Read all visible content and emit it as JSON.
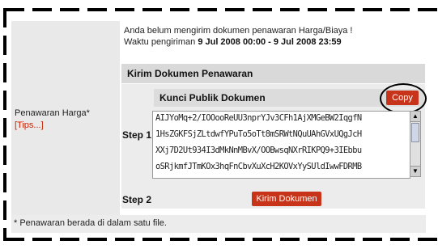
{
  "notice": {
    "line1": "Anda belum mengirim dokumen penawaran Harga/Biaya !",
    "line2_prefix": "Waktu pengiriman ",
    "line2_range": "9 Jul 2008 00:00 - 9 Jul 2008 23:59"
  },
  "left": {
    "label": "Penawaran Harga*",
    "tips": "[Tips...]"
  },
  "kirim": {
    "title": "Kirim Dokumen Penawaran"
  },
  "step1": {
    "label": "Step 1",
    "kunci_title": "Kunci Publik Dokumen",
    "copy_label": "Copy",
    "key_lines": [
      "AIJYoMq+2/IOOooReUU3nprYJv3CFh1AjXMGeBW2IqgfN",
      "1HsZGKFSjZLtdwfYPuTo5oTt8mSRWtNQuUAhGVxUQgJcH",
      "XXj7D2Ut934I3dMkNnMBvX/OOBwsqNXrRIKPQ9+3IEbbu",
      "oSRjkmfJTmKOx3hqFnCbvXuXcH2KOVxYySUldIwwFDRMB"
    ]
  },
  "step2": {
    "label": "Step 2",
    "button_label": "Kirim Dokumen"
  },
  "footnote": "* Penawaran berada di dalam satu file.",
  "colors": {
    "accent_button": "#c8341a",
    "tips_text": "#cc2200",
    "header_gray": "#d9d9d9"
  }
}
